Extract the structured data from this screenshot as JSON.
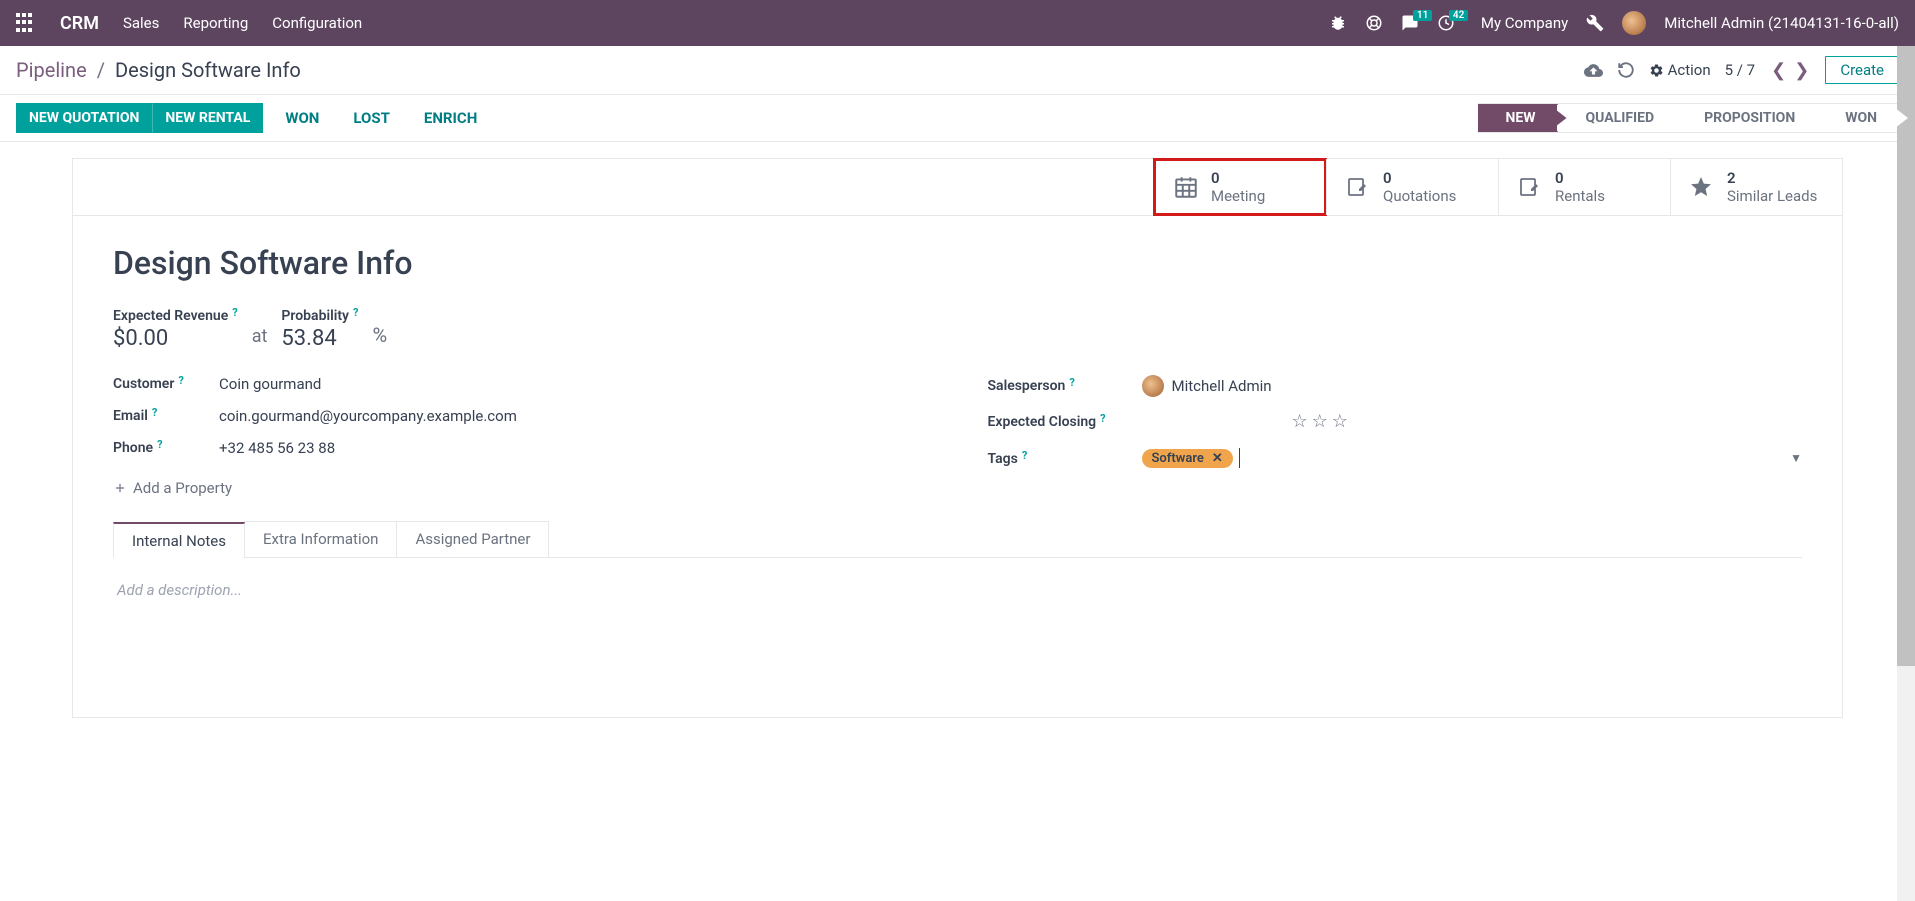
{
  "nav": {
    "brand": "CRM",
    "items": [
      "Sales",
      "Reporting",
      "Configuration"
    ],
    "msg_badge": "11",
    "clock_badge": "42",
    "company": "My Company",
    "user": "Mitchell Admin (21404131-16-0-all)"
  },
  "crumbs": {
    "parent": "Pipeline",
    "current": "Design Software Info",
    "action_label": "Action",
    "pager": "5 / 7",
    "create": "Create"
  },
  "status": {
    "btn_quote": "NEW QUOTATION",
    "btn_rental": "NEW RENTAL",
    "btn_won": "WON",
    "btn_lost": "LOST",
    "btn_enrich": "ENRICH",
    "stages": [
      "NEW",
      "QUALIFIED",
      "PROPOSITION",
      "WON"
    ],
    "active_stage": "NEW"
  },
  "stats": {
    "meeting": {
      "val": "0",
      "label": "Meeting"
    },
    "quotations": {
      "val": "0",
      "label": "Quotations"
    },
    "rentals": {
      "val": "0",
      "label": "Rentals"
    },
    "similar": {
      "val": "2",
      "label": "Similar Leads"
    }
  },
  "form": {
    "title": "Design Software Info",
    "expected_revenue_label": "Expected Revenue",
    "expected_revenue": "$0.00",
    "at": "at",
    "probability_label": "Probability",
    "probability": "53.84",
    "pct": "%",
    "customer_label": "Customer",
    "customer": "Coin gourmand",
    "email_label": "Email",
    "email": "coin.gourmand@yourcompany.example.com",
    "phone_label": "Phone",
    "phone": "+32 485 56 23 88",
    "salesperson_label": "Salesperson",
    "salesperson": "Mitchell Admin",
    "closing_label": "Expected Closing",
    "tags_label": "Tags",
    "tag": "Software",
    "add_prop": "Add a Property",
    "hint": "?"
  },
  "tabs": {
    "t1": "Internal Notes",
    "t2": "Extra Information",
    "t3": "Assigned Partner",
    "desc_placeholder": "Add a description..."
  }
}
